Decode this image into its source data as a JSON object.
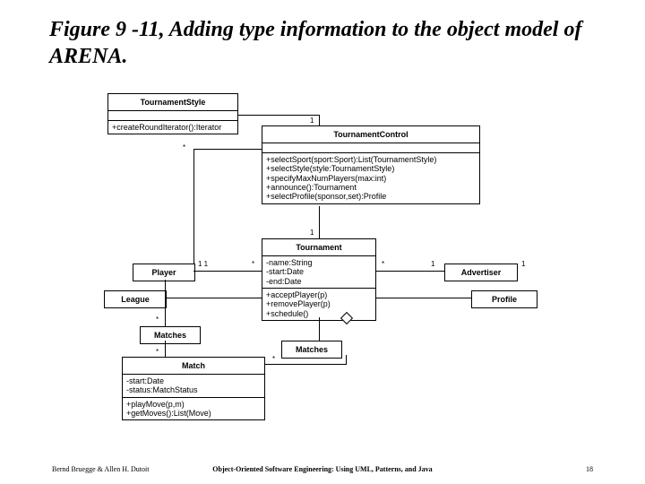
{
  "title": "Figure 9 -11, Adding type information to the object model of ARENA.",
  "classes": {
    "tsi": {
      "name": "TournamentStyle"
    },
    "tsiop": "+createRoundIterator():Iterator",
    "tc": {
      "name": "TournamentControl"
    },
    "tcops": [
      "+selectSport(sport:Sport):List(TournamentStyle)",
      "+selectStyle(style:TournamentStyle)",
      "+specifyMaxNumPlayers(max:int)",
      "+announce():Tournament",
      "+selectProfile(sponsor,set):Profile"
    ],
    "tr": {
      "name": "Tournament"
    },
    "trattrs": [
      "-name:String",
      "-start:Date",
      "-end:Date"
    ],
    "trops": [
      "+acceptPlayer(p)",
      "+removePlayer(p)",
      "+schedule()"
    ],
    "player": {
      "name": "Player"
    },
    "league": {
      "name": "League"
    },
    "adv": {
      "name": "Advertiser"
    },
    "profile": {
      "name": "Profile"
    },
    "matches": {
      "name": "Matches"
    },
    "match": {
      "name": "Match"
    },
    "matchattrs": [
      "-start:Date",
      "-status:MatchStatus"
    ],
    "matchops": [
      "+playMove(p,m)",
      "+getMoves():List(Move)"
    ]
  },
  "mults": {
    "one": "1",
    "star": "*",
    "oneone": "1   1"
  },
  "footer": {
    "left": "Bernd Bruegge & Allen H. Dutoit",
    "center": "Object-Oriented Software Engineering: Using UML, Patterns, and Java",
    "right": "18"
  }
}
